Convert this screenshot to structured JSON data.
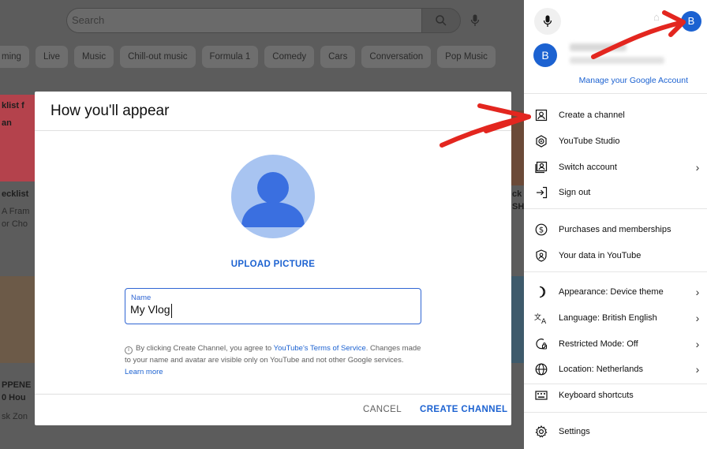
{
  "background": {
    "search_placeholder": "Search",
    "chips": [
      "ming",
      "Live",
      "Music",
      "Chill-out music",
      "Formula 1",
      "Comedy",
      "Cars",
      "Conversation",
      "Pop Music"
    ],
    "fragments": [
      "klist f",
      "an",
      "ecklist",
      "A Fram",
      "or Cho",
      "PPENE",
      "0 Hou",
      "sk Zon",
      "ck",
      "SH"
    ]
  },
  "dialog": {
    "title": "How you'll appear",
    "upload_label": "UPLOAD PICTURE",
    "name_label": "Name",
    "name_value": "My Vlog",
    "notice_1": "By clicking Create Channel, you agree to ",
    "notice_link_1": "YouTube's Terms of Service",
    "notice_2": ". Changes made to your name and avatar are visible only on YouTube and not other Google services. ",
    "notice_link_2": "Learn more",
    "cancel": "CANCEL",
    "create": "CREATE CHANNEL"
  },
  "account": {
    "avatar_letter": "B",
    "manage": "Manage your Google Account",
    "menu": [
      {
        "label": "Create a channel",
        "icon": "person-icon",
        "chevron": false
      },
      {
        "label": "YouTube Studio",
        "icon": "studio-icon",
        "chevron": false
      },
      {
        "label": "Switch account",
        "icon": "switch-account-icon",
        "chevron": true
      },
      {
        "label": "Sign out",
        "icon": "sign-out-icon",
        "chevron": false
      },
      {
        "label": "Purchases and memberships",
        "icon": "dollar-icon",
        "chevron": false
      },
      {
        "label": "Your data in YouTube",
        "icon": "shield-person-icon",
        "chevron": false
      },
      {
        "label": "Appearance: Device theme",
        "icon": "moon-icon",
        "chevron": true
      },
      {
        "label": "Language: British English",
        "icon": "translate-icon",
        "chevron": true
      },
      {
        "label": "Restricted Mode: Off",
        "icon": "restricted-icon",
        "chevron": true
      },
      {
        "label": "Location: Netherlands",
        "icon": "globe-icon",
        "chevron": true
      },
      {
        "label": "Keyboard shortcuts",
        "icon": "keyboard-icon",
        "chevron": false
      },
      {
        "label": "Settings",
        "icon": "gear-icon",
        "chevron": false
      }
    ]
  },
  "colors": {
    "accent": "#1c62d1",
    "arrow": "#e3261f"
  }
}
